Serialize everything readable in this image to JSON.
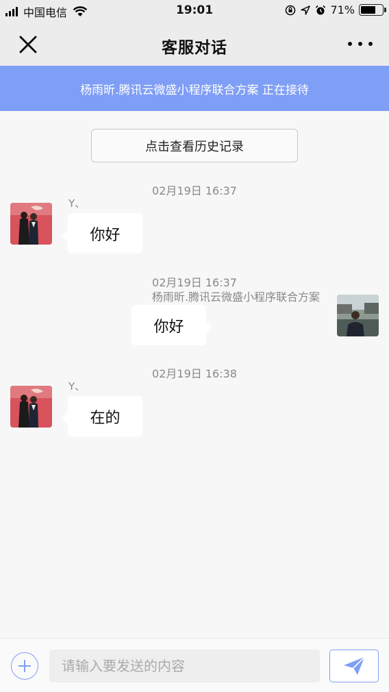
{
  "status_bar": {
    "carrier": "中国电信",
    "time": "19:01",
    "battery_text": "71%",
    "battery_level": 0.71,
    "icons": [
      "signal-icon",
      "wifi-icon",
      "orientation-lock-icon",
      "location-icon",
      "alarm-icon",
      "battery-icon"
    ]
  },
  "nav": {
    "title": "客服对话",
    "close_icon": "close-icon",
    "more_icon": "more-icon"
  },
  "banner": {
    "text": "杨雨昕.腾讯云微盛小程序联合方案 正在接待"
  },
  "history_button": {
    "label": "点击查看历史记录"
  },
  "messages": [
    {
      "timestamp": "02月19日 16:37",
      "sender": "Y、",
      "side": "left",
      "text": "你好"
    },
    {
      "timestamp": "02月19日 16:37",
      "sender": "杨雨昕.腾讯云微盛小程序联合方案",
      "side": "right",
      "text": "你好"
    },
    {
      "timestamp": "02月19日 16:38",
      "sender": "Y、",
      "side": "left",
      "text": "在的"
    }
  ],
  "input": {
    "placeholder": "请输入要发送的内容",
    "value": ""
  },
  "colors": {
    "accent": "#7f9ef5",
    "background": "#f7f7f7",
    "bubble": "#ffffff",
    "muted_text": "#888888"
  }
}
